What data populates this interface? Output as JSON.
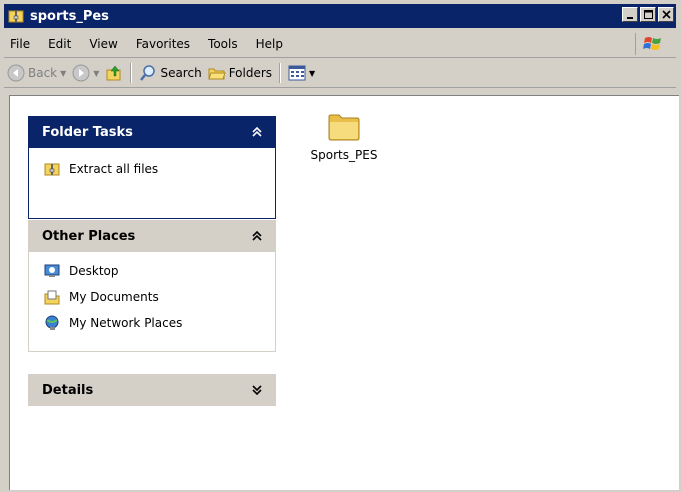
{
  "window": {
    "title": "sports_Pes"
  },
  "menu": [
    "File",
    "Edit",
    "View",
    "Favorites",
    "Tools",
    "Help"
  ],
  "toolbar": {
    "back": "Back",
    "search": "Search",
    "folders": "Folders"
  },
  "panels": {
    "folder_tasks": {
      "title": "Folder Tasks",
      "items": [
        "Extract all files"
      ]
    },
    "other_places": {
      "title": "Other Places",
      "items": [
        "Desktop",
        "My Documents",
        "My Network Places"
      ]
    },
    "details": {
      "title": "Details"
    }
  },
  "files": [
    {
      "name": "Sports_PES",
      "icon": "folder-icon"
    }
  ],
  "colors": {
    "title_bar": "#0a246a",
    "window_bg": "#d4d0c8",
    "content_bg": "#ffffff",
    "folder": "#f4d35e"
  }
}
